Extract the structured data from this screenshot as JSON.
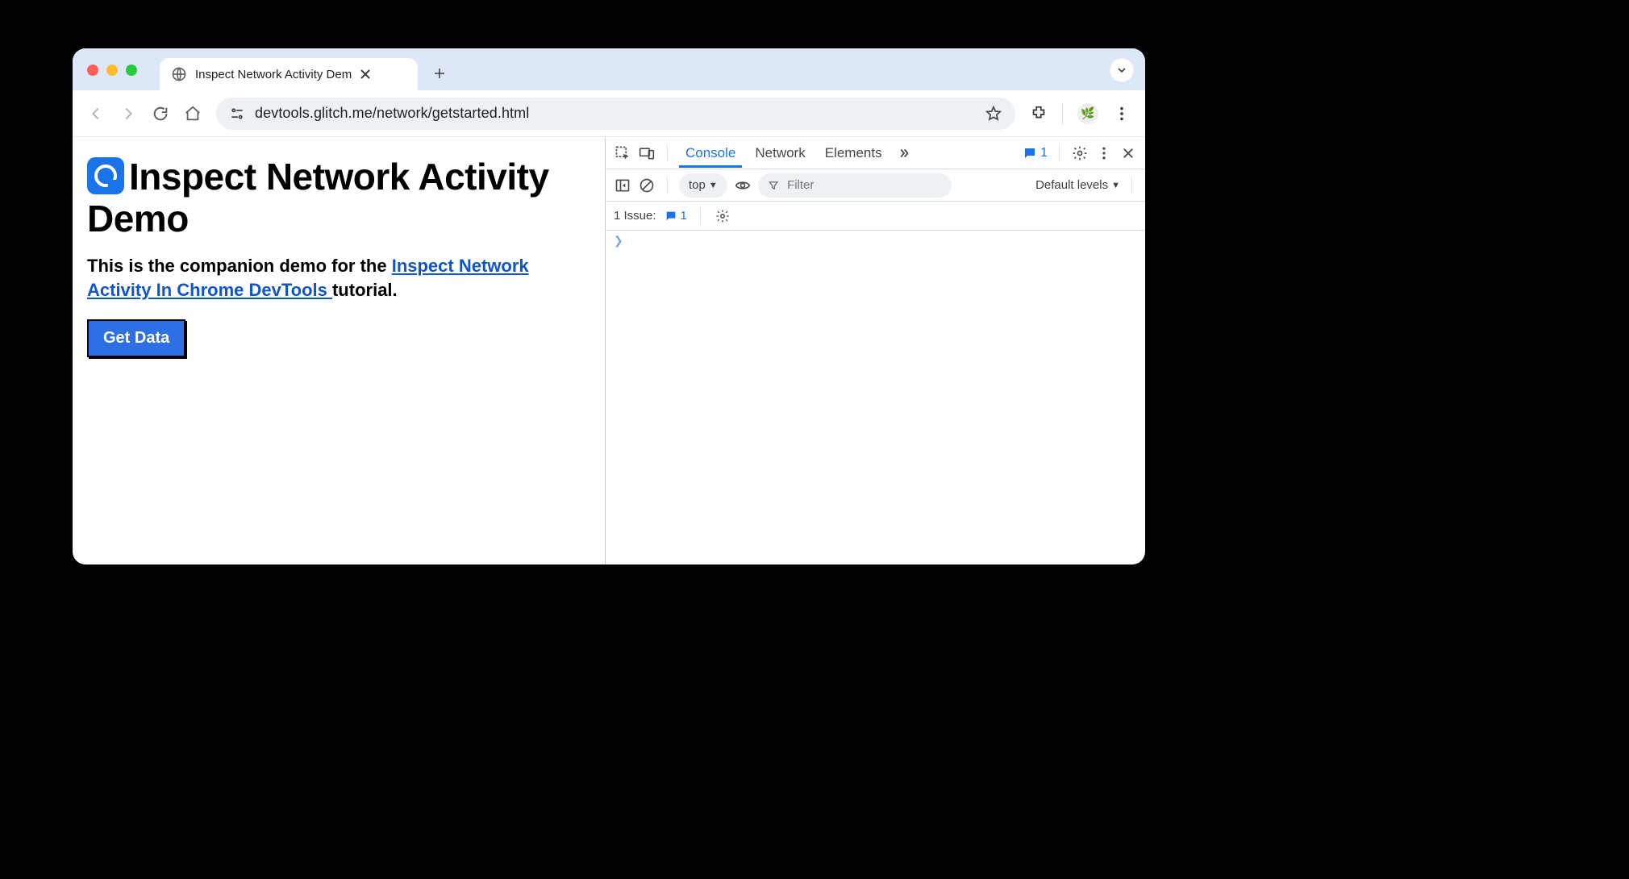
{
  "browser": {
    "tab_title": "Inspect Network Activity Dem",
    "url": "devtools.glitch.me/network/getstarted.html"
  },
  "page": {
    "heading": "Inspect Network Activity Demo",
    "para_prefix": "This is the companion demo for the ",
    "link_text": "Inspect Network Activity In Chrome DevTools ",
    "para_suffix": "tutorial.",
    "button_label": "Get Data"
  },
  "devtools": {
    "tabs": {
      "console": "Console",
      "network": "Network",
      "elements": "Elements"
    },
    "issues_count": "1",
    "context_label": "top",
    "filter_placeholder": "Filter",
    "levels_label": "Default levels",
    "issues_label": "1 Issue:",
    "issues_chip": "1"
  }
}
